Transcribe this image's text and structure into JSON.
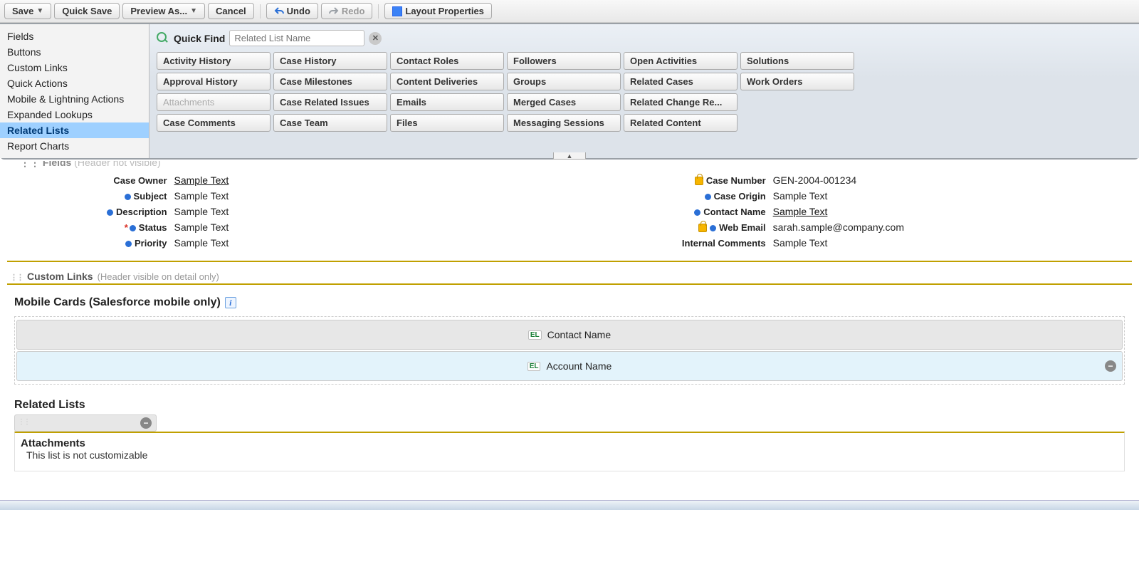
{
  "toolbar": {
    "save": "Save",
    "quick_save": "Quick Save",
    "preview_as": "Preview As...",
    "cancel": "Cancel",
    "undo": "Undo",
    "redo": "Redo",
    "layout_properties": "Layout Properties"
  },
  "sidebar": {
    "items": [
      {
        "label": "Fields"
      },
      {
        "label": "Buttons"
      },
      {
        "label": "Custom Links"
      },
      {
        "label": "Quick Actions"
      },
      {
        "label": "Mobile & Lightning Actions"
      },
      {
        "label": "Expanded Lookups"
      },
      {
        "label": "Related Lists"
      },
      {
        "label": "Report Charts"
      }
    ],
    "selected_index": 6
  },
  "quickfind": {
    "label": "Quick Find",
    "placeholder": "Related List Name"
  },
  "palette_items": [
    {
      "label": "Activity History"
    },
    {
      "label": "Case History"
    },
    {
      "label": "Contact Roles"
    },
    {
      "label": "Followers"
    },
    {
      "label": "Open Activities"
    },
    {
      "label": "Solutions"
    },
    {
      "label": "Approval History"
    },
    {
      "label": "Case Milestones"
    },
    {
      "label": "Content Deliveries"
    },
    {
      "label": "Groups"
    },
    {
      "label": "Related Cases"
    },
    {
      "label": "Work Orders"
    },
    {
      "label": "Attachments",
      "disabled": true
    },
    {
      "label": "Case Related Issues"
    },
    {
      "label": "Emails"
    },
    {
      "label": "Merged Cases"
    },
    {
      "label": "Related Change Re..."
    },
    {
      "label": "",
      "blank": true
    },
    {
      "label": "Case Comments"
    },
    {
      "label": "Case Team"
    },
    {
      "label": "Files"
    },
    {
      "label": "Messaging Sessions"
    },
    {
      "label": "Related Content"
    },
    {
      "label": "",
      "blank": true
    }
  ],
  "fields_header": {
    "title": "Fields",
    "sub": "(Header not visible)"
  },
  "fields_left": [
    {
      "label": "Case Owner",
      "value": "Sample Text",
      "link": true
    },
    {
      "label": "Subject",
      "value": "Sample Text",
      "dot": true
    },
    {
      "label": "Description",
      "value": "Sample Text",
      "dot": true
    },
    {
      "label": "Status",
      "value": "Sample Text",
      "dot": true,
      "required": true
    },
    {
      "label": "Priority",
      "value": "Sample Text",
      "dot": true
    }
  ],
  "fields_right": [
    {
      "label": "Case Number",
      "value": "GEN-2004-001234",
      "lock": true
    },
    {
      "label": "Case Origin",
      "value": "Sample Text",
      "dot": true
    },
    {
      "label": "Contact Name",
      "value": "Sample Text",
      "dot": true,
      "link": true
    },
    {
      "label": "Web Email",
      "value": "sarah.sample@company.com",
      "lock": true,
      "dot": true
    },
    {
      "label": "Internal Comments",
      "value": "Sample Text"
    }
  ],
  "custom_links": {
    "title": "Custom Links",
    "sub": "(Header visible on detail only)"
  },
  "mobile_cards": {
    "title": "Mobile Cards (Salesforce mobile only)",
    "rows": [
      {
        "label": "Contact Name",
        "style": "gray"
      },
      {
        "label": "Account Name",
        "style": "blue",
        "removable": true
      }
    ]
  },
  "related_lists": {
    "title": "Related Lists",
    "attachments_title": "Attachments",
    "attachments_sub": "This list is not customizable"
  }
}
